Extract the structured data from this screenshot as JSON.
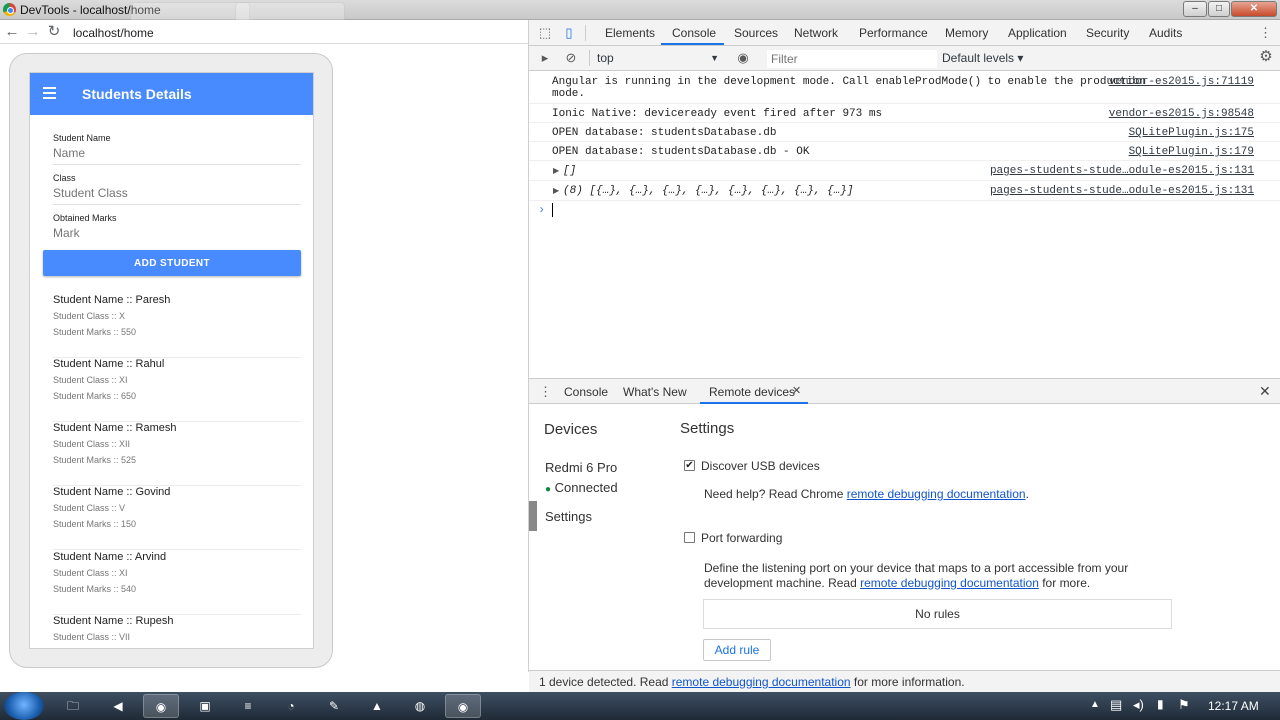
{
  "window": {
    "title": "DevTools - localhost/home"
  },
  "browser": {
    "url": "localhost/home"
  },
  "app": {
    "title": "Students Details",
    "fields": [
      {
        "label": "Student Name",
        "placeholder": "Name"
      },
      {
        "label": "Class",
        "placeholder": "Student Class"
      },
      {
        "label": "Obtained Marks",
        "placeholder": "Mark"
      }
    ],
    "add_button": "ADD STUDENT",
    "students": [
      {
        "name": "Student Name :: Paresh",
        "class": "Student Class :: X",
        "marks": "Student Marks :: 550"
      },
      {
        "name": "Student Name :: Rahul",
        "class": "Student Class :: XI",
        "marks": "Student Marks :: 650"
      },
      {
        "name": "Student Name :: Ramesh",
        "class": "Student Class :: XII",
        "marks": "Student Marks :: 525"
      },
      {
        "name": "Student Name :: Govind",
        "class": "Student Class :: V",
        "marks": "Student Marks :: 150"
      },
      {
        "name": "Student Name :: Arvind",
        "class": "Student Class :: XI",
        "marks": "Student Marks :: 540"
      },
      {
        "name": "Student Name :: Rupesh",
        "class": "Student Class :: VII",
        "marks": ""
      }
    ]
  },
  "devtools": {
    "tabs": [
      "Elements",
      "Console",
      "Sources",
      "Network",
      "Performance",
      "Memory",
      "Application",
      "Security",
      "Audits"
    ],
    "active_tab": "Console",
    "context": "top",
    "filter_placeholder": "Filter",
    "levels": "Default levels ▾",
    "console": [
      {
        "msg": "Angular is running in the development mode. Call enableProdMode() to enable the production\nmode.",
        "src": "vendor-es2015.js:71119"
      },
      {
        "msg": "Ionic Native: deviceready event fired after 973 ms",
        "src": "vendor-es2015.js:98548"
      },
      {
        "msg": "OPEN database: studentsDatabase.db",
        "src": "SQLitePlugin.js:175"
      },
      {
        "msg": "OPEN database: studentsDatabase.db - OK",
        "src": "SQLitePlugin.js:179"
      },
      {
        "msg": "[]",
        "src": "pages-students-stude…odule-es2015.js:131"
      },
      {
        "msg": "(8) [{…}, {…}, {…}, {…}, {…}, {…}, {…}, {…}]",
        "src": "pages-students-stude…odule-es2015.js:131"
      }
    ],
    "drawer_tabs": [
      "Console",
      "What's New",
      "Remote devices"
    ],
    "remote": {
      "devices_heading": "Devices",
      "device_name": "Redmi 6 Pro",
      "device_status": "Connected",
      "settings_nav": "Settings",
      "settings_heading": "Settings",
      "discover_usb": "Discover USB devices",
      "help_prefix": "Need help? Read Chrome ",
      "help_link": "remote debugging documentation",
      "help_suffix": ".",
      "port_forwarding": "Port forwarding",
      "port_desc_1": "Define the listening port on your device that maps to a port accessible from your",
      "port_desc_2": "development machine. Read ",
      "port_desc_link": "remote debugging documentation",
      "port_desc_3": " for more.",
      "no_rules": "No rules",
      "add_rule": "Add rule"
    },
    "status": {
      "prefix": "1 device detected. Read ",
      "link": "remote debugging documentation",
      "suffix": " for more information."
    }
  },
  "taskbar": {
    "time": "12:17 AM"
  },
  "colors": {
    "ionic_primary": "#488aff",
    "devtools_accent": "#1a73e8",
    "connected": "#0a8a3a"
  }
}
